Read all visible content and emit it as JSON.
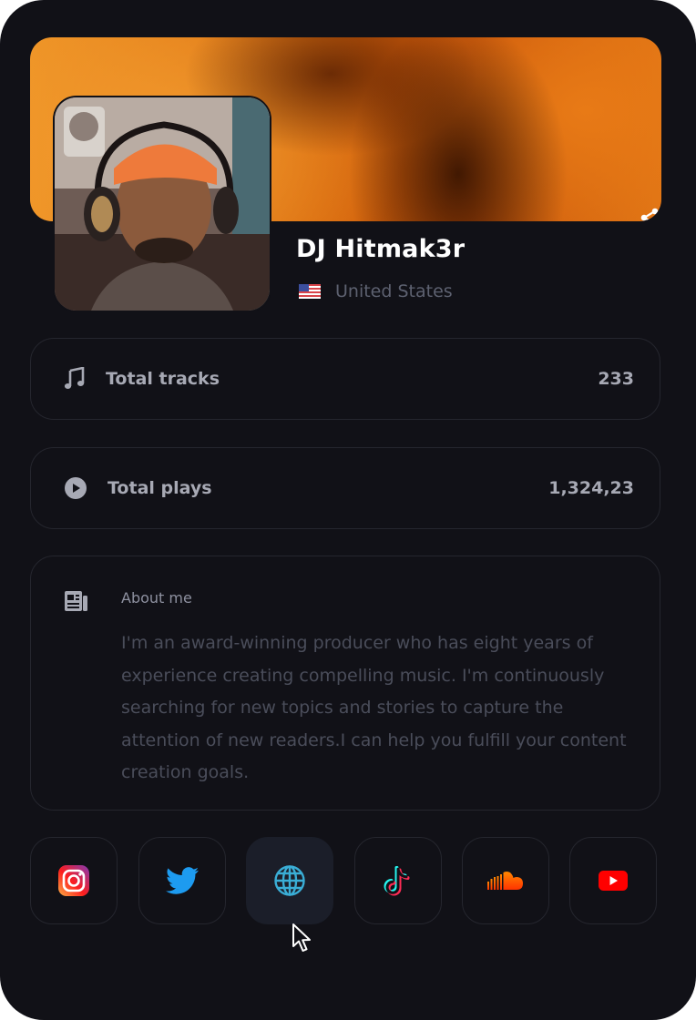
{
  "profile": {
    "name": "DJ Hitmak3r",
    "country": "United States",
    "flag": "us-flag-icon"
  },
  "stats": [
    {
      "icon": "music-note-icon",
      "label": "Total tracks",
      "value": "233"
    },
    {
      "icon": "play-circle-icon",
      "label": "Total plays",
      "value": "1,324,23"
    }
  ],
  "about": {
    "icon": "newspaper-icon",
    "title": "About me",
    "body": "I'm an award-winning producer who has eight years of experience creating compelling music. I'm continuously searching for new topics and stories to capture the attention of new readers.I can help you fulfill your content creation goals."
  },
  "socials": [
    {
      "name": "instagram",
      "icon": "instagram-icon",
      "active": false
    },
    {
      "name": "twitter",
      "icon": "twitter-icon",
      "active": false
    },
    {
      "name": "website",
      "icon": "globe-icon",
      "active": true
    },
    {
      "name": "tiktok",
      "icon": "tiktok-icon",
      "active": false
    },
    {
      "name": "soundcloud",
      "icon": "soundcloud-icon",
      "active": false
    },
    {
      "name": "youtube",
      "icon": "youtube-icon",
      "active": false
    }
  ],
  "colors": {
    "card_background": "#111117",
    "banner_orange": "#e07515",
    "text_primary": "#ffffff",
    "text_muted": "#a7a9b4",
    "border": "#25262e",
    "globe": "#3aaed6"
  }
}
